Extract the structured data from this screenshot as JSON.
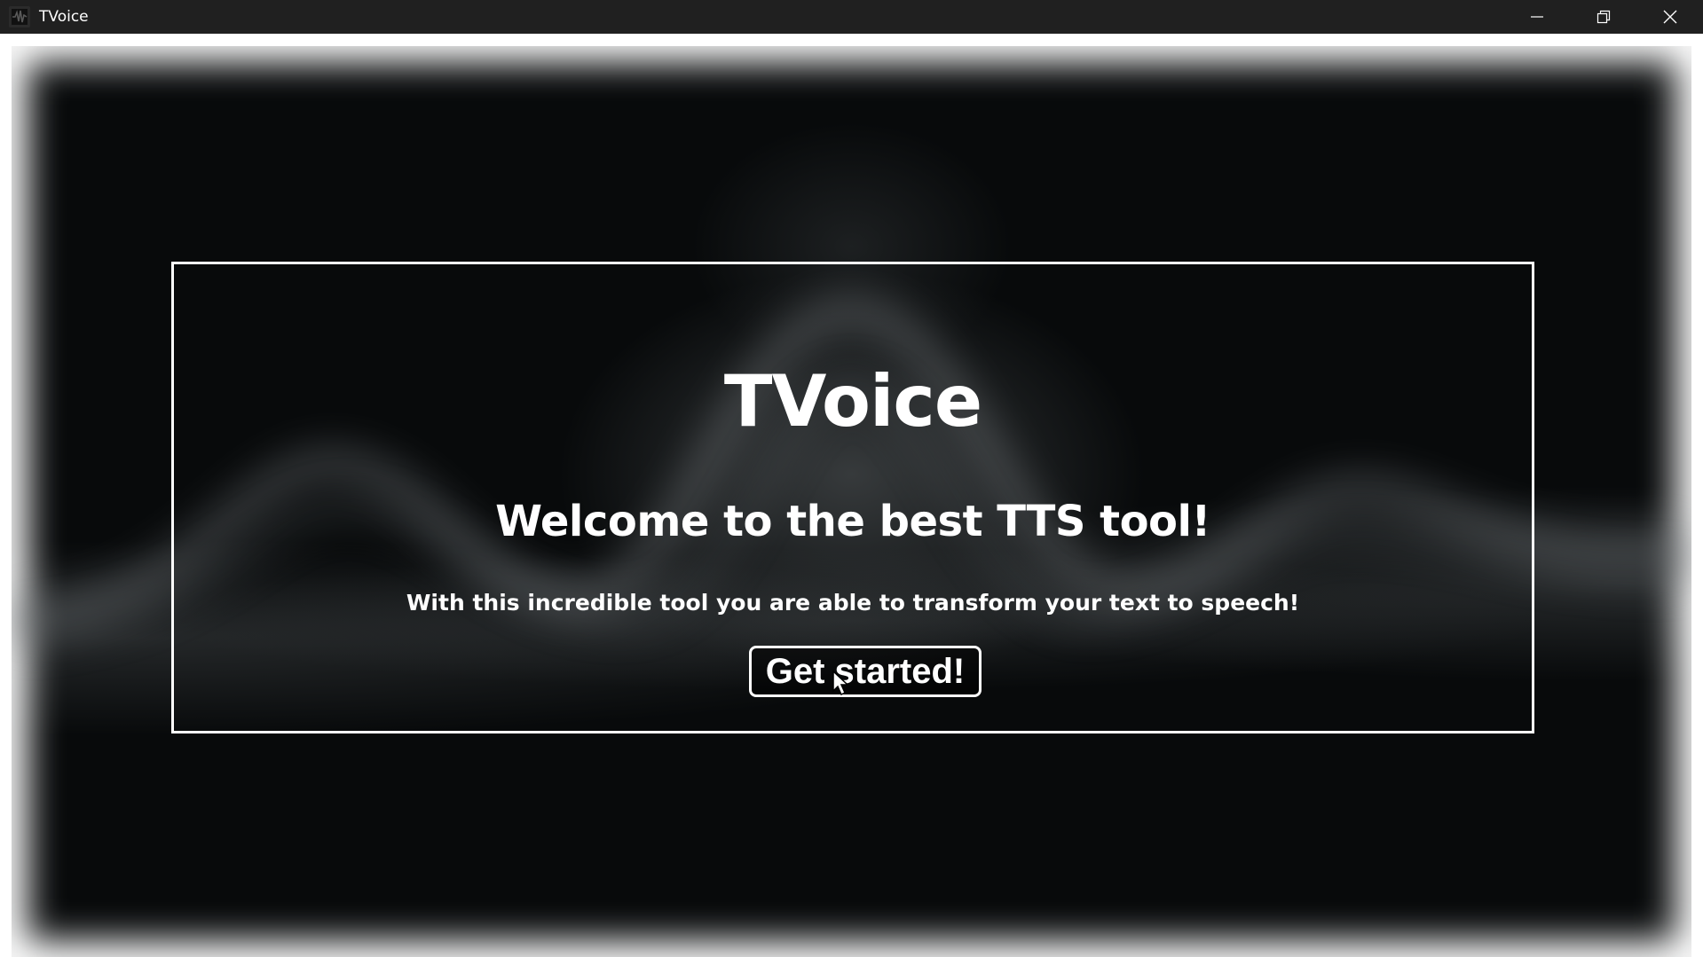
{
  "window": {
    "title": "TVoice",
    "controls": [
      "minimize-icon",
      "restore-icon",
      "close-icon"
    ]
  },
  "main": {
    "heading": "TVoice",
    "welcome": "Welcome to the best TTS tool!",
    "description": "With this incredible tool you are able to transform your text to speech!",
    "cta_label": "Get started!"
  },
  "colors": {
    "titlebar": "#202020",
    "background": "#080a0b",
    "text": "#ffffff",
    "frame_border": "#ffffff"
  }
}
